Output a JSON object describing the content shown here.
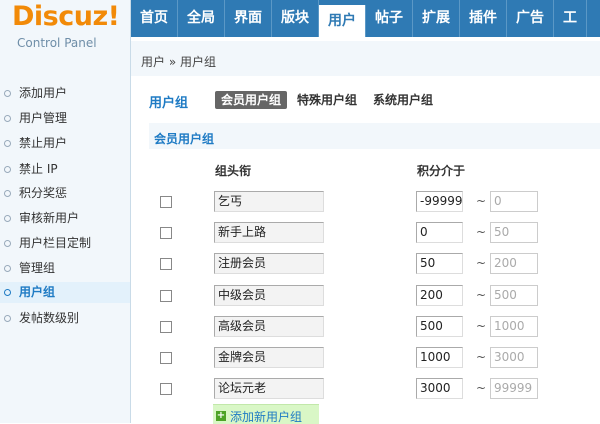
{
  "logo": {
    "word": "Discuz!",
    "sub": "Control Panel"
  },
  "topnav": {
    "tabs": [
      {
        "label": "首页"
      },
      {
        "label": "全局"
      },
      {
        "label": "界面"
      },
      {
        "label": "版块"
      },
      {
        "label": "用户"
      },
      {
        "label": "帖子"
      },
      {
        "label": "扩展"
      },
      {
        "label": "插件"
      },
      {
        "label": "广告"
      },
      {
        "label": "工"
      }
    ],
    "active": "用户"
  },
  "breadcrumb": {
    "text": "用户 » 用户组"
  },
  "sidebar": {
    "items": [
      {
        "label": "添加用户"
      },
      {
        "label": "用户管理"
      },
      {
        "label": "禁止用户"
      },
      {
        "label": "禁止 IP"
      },
      {
        "label": "积分奖惩"
      },
      {
        "label": "审核新用户"
      },
      {
        "label": "用户栏目定制"
      },
      {
        "label": "管理组"
      },
      {
        "label": "用户组"
      },
      {
        "label": "发帖数级别"
      }
    ],
    "active": "用户组"
  },
  "main": {
    "title": "用户组",
    "subtabs": [
      {
        "label": "会员用户组"
      },
      {
        "label": "特殊用户组"
      },
      {
        "label": "系统用户组"
      }
    ],
    "active_subtab": "会员用户组",
    "section_title": "会员用户组",
    "columns": {
      "name": "组头衔",
      "range": "积分介于"
    },
    "rows": [
      {
        "name": "乞丐",
        "from": "-99999",
        "to": "0"
      },
      {
        "name": "新手上路",
        "from": "0",
        "to": "50"
      },
      {
        "name": "注册会员",
        "from": "50",
        "to": "200"
      },
      {
        "name": "中级会员",
        "from": "200",
        "to": "500"
      },
      {
        "name": "高级会员",
        "from": "500",
        "to": "1000"
      },
      {
        "name": "金牌会员",
        "from": "1000",
        "to": "3000"
      },
      {
        "name": "论坛元老",
        "from": "3000",
        "to": "99999"
      }
    ],
    "tilde": "~",
    "add_label": "添加新用户组"
  },
  "colors": {
    "accent": "#2f7ab4",
    "logo": "#f28a08",
    "add_bg": "#d9f7c6"
  }
}
